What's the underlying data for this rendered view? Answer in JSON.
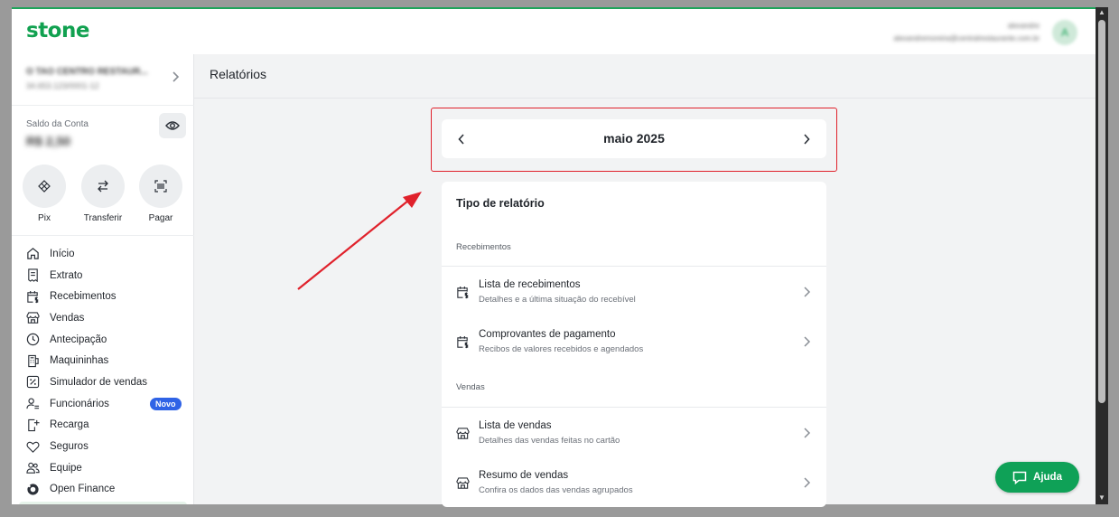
{
  "brand": {
    "logo": "stone",
    "accent": "#11a150",
    "highlight": "#e0212b",
    "new_badge": "#2f63e6"
  },
  "user": {
    "name": "alexandre",
    "email": "alexandremoreira@centralrestaurante.com.br",
    "initial": "A"
  },
  "account": {
    "name": "O TAO CENTRO RESTAUR...",
    "doc": "34.653.123/0001-12"
  },
  "balance": {
    "label": "Saldo da Conta",
    "value": "R$ 2,50",
    "eye_icon": "eye-icon"
  },
  "quick_actions": [
    {
      "label": "Pix",
      "icon": "pix-icon"
    },
    {
      "label": "Transferir",
      "icon": "transfer-icon"
    },
    {
      "label": "Pagar",
      "icon": "barcode-icon"
    }
  ],
  "nav": [
    {
      "label": "Início",
      "icon": "home-icon"
    },
    {
      "label": "Extrato",
      "icon": "statement-icon"
    },
    {
      "label": "Recebimentos",
      "icon": "calendar-money-icon"
    },
    {
      "label": "Vendas",
      "icon": "store-icon"
    },
    {
      "label": "Antecipação",
      "icon": "clock-icon"
    },
    {
      "label": "Maquininhas",
      "icon": "card-machine-icon"
    },
    {
      "label": "Simulador de vendas",
      "icon": "percent-icon"
    },
    {
      "label": "Funcionários",
      "icon": "people-settings-icon",
      "badge": "Novo"
    },
    {
      "label": "Recarga",
      "icon": "recharge-icon"
    },
    {
      "label": "Seguros",
      "icon": "heart-icon"
    },
    {
      "label": "Equipe",
      "icon": "team-icon"
    },
    {
      "label": "Open Finance",
      "icon": "open-finance-icon"
    }
  ],
  "page": {
    "title": "Relatórios"
  },
  "month_selector": {
    "label": "maio 2025"
  },
  "report": {
    "title": "Tipo de relatório",
    "sections": [
      {
        "label": "Recebimentos",
        "items": [
          {
            "title": "Lista de recebimentos",
            "desc": "Detalhes e a última situação do recebível",
            "icon": "calendar-money-icon"
          },
          {
            "title": "Comprovantes de pagamento",
            "desc": "Recibos de valores recebidos e agendados",
            "icon": "calendar-money-icon"
          }
        ]
      },
      {
        "label": "Vendas",
        "items": [
          {
            "title": "Lista de vendas",
            "desc": "Detalhes das vendas feitas no cartão",
            "icon": "store-icon"
          },
          {
            "title": "Resumo de vendas",
            "desc": "Confira os dados das vendas agrupados",
            "icon": "store-icon"
          }
        ]
      }
    ]
  },
  "help": {
    "label": "Ajuda"
  }
}
